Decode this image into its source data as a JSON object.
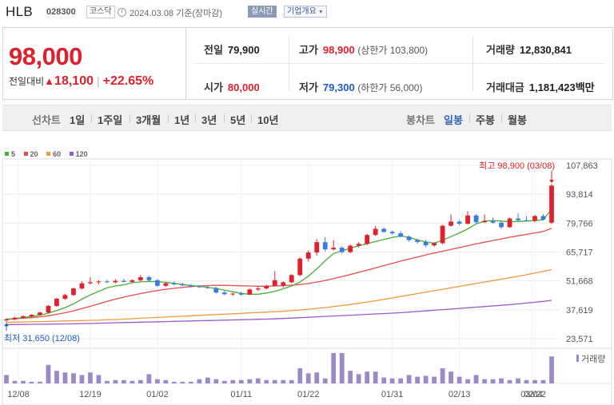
{
  "header": {
    "name": "HLB",
    "code": "028300",
    "market": "코스닥",
    "date": "2024.03.08 기준(장마감)",
    "realtime": "실시간",
    "company_info": "기업개요"
  },
  "quote": {
    "price": "98,000",
    "change_label": "전일대비",
    "change_value": "18,100",
    "change_rate": "+22.65%",
    "prev_close_label": "전일",
    "prev_close": "79,900",
    "high_label": "고가",
    "high": "98,900",
    "upper_limit": "(상한가 103,800)",
    "volume_label": "거래량",
    "volume": "12,830,841",
    "open_label": "시가",
    "open": "80,000",
    "low_label": "저가",
    "low": "79,300",
    "lower_limit": "(하한가 56,000)",
    "amount_label": "거래대금",
    "amount": "1,181,423",
    "amount_unit": "백만"
  },
  "period_tabs": {
    "label": "선차트",
    "items": [
      "1일",
      "1주일",
      "3개월",
      "1년",
      "3년",
      "5년",
      "10년"
    ]
  },
  "candle_tabs": {
    "label": "봉차트",
    "items": [
      "일봉",
      "주봉",
      "월봉"
    ],
    "active": "일봉"
  },
  "colors": {
    "up": "#e0202c",
    "down": "#3a7be0",
    "ma5": "#45b035",
    "ma20": "#e84c4c",
    "ma60": "#f09a3e",
    "ma120": "#9b59c9",
    "volume": "#9b8ac9"
  },
  "chart_data": {
    "type": "candlestick",
    "legend": [
      "5",
      "20",
      "60",
      "120"
    ],
    "y_ticks": [
      "107,863",
      "93,814",
      "79,766",
      "65,717",
      "51,668",
      "37,619",
      "23,571"
    ],
    "y_range": [
      23571,
      107863
    ],
    "x_ticks": [
      "12/08",
      "12/19",
      "01/02",
      "01/11",
      "01/22",
      "01/31",
      "02/13",
      "02/22",
      "03/04"
    ],
    "high_annotation": "최고 98,900 (03/08)",
    "low_annotation": "최저 31,650 (12/08)",
    "volume_label": "거래량",
    "candles": [
      {
        "o": 32500,
        "h": 33500,
        "l": 31650,
        "c": 33000
      },
      {
        "o": 33000,
        "h": 34200,
        "l": 32600,
        "c": 33800
      },
      {
        "o": 33800,
        "h": 35000,
        "l": 33400,
        "c": 34500
      },
      {
        "o": 34500,
        "h": 35500,
        "l": 34000,
        "c": 35200
      },
      {
        "o": 35200,
        "h": 36800,
        "l": 34900,
        "c": 36300
      },
      {
        "o": 36300,
        "h": 40000,
        "l": 36000,
        "c": 39500
      },
      {
        "o": 39500,
        "h": 43500,
        "l": 39000,
        "c": 43000
      },
      {
        "o": 43000,
        "h": 45500,
        "l": 42500,
        "c": 44800
      },
      {
        "o": 44800,
        "h": 48500,
        "l": 44500,
        "c": 48000
      },
      {
        "o": 48000,
        "h": 51500,
        "l": 47500,
        "c": 50500
      },
      {
        "o": 50500,
        "h": 53500,
        "l": 50000,
        "c": 51000
      },
      {
        "o": 51000,
        "h": 52000,
        "l": 50000,
        "c": 51400
      },
      {
        "o": 51400,
        "h": 52200,
        "l": 50600,
        "c": 51000
      },
      {
        "o": 51000,
        "h": 52500,
        "l": 50500,
        "c": 51700
      },
      {
        "o": 51700,
        "h": 52700,
        "l": 50900,
        "c": 51200
      },
      {
        "o": 51200,
        "h": 52500,
        "l": 50800,
        "c": 52000
      },
      {
        "o": 52000,
        "h": 54500,
        "l": 51500,
        "c": 53500
      },
      {
        "o": 53500,
        "h": 54200,
        "l": 51500,
        "c": 52000
      },
      {
        "o": 52000,
        "h": 52600,
        "l": 48800,
        "c": 49300
      },
      {
        "o": 49300,
        "h": 51200,
        "l": 48800,
        "c": 50500
      },
      {
        "o": 50500,
        "h": 51500,
        "l": 49500,
        "c": 50000
      },
      {
        "o": 50000,
        "h": 50800,
        "l": 49200,
        "c": 49500
      },
      {
        "o": 49500,
        "h": 50200,
        "l": 48500,
        "c": 49000
      },
      {
        "o": 49000,
        "h": 49600,
        "l": 48200,
        "c": 48600
      },
      {
        "o": 48600,
        "h": 49200,
        "l": 47800,
        "c": 48200
      },
      {
        "o": 48200,
        "h": 48800,
        "l": 45500,
        "c": 46000
      },
      {
        "o": 46000,
        "h": 46800,
        "l": 44800,
        "c": 45200
      },
      {
        "o": 45200,
        "h": 46000,
        "l": 44500,
        "c": 45500
      },
      {
        "o": 45500,
        "h": 46500,
        "l": 44500,
        "c": 45000
      },
      {
        "o": 45000,
        "h": 48000,
        "l": 44800,
        "c": 47500
      },
      {
        "o": 47500,
        "h": 49000,
        "l": 46800,
        "c": 48000
      },
      {
        "o": 48000,
        "h": 49800,
        "l": 47500,
        "c": 49200
      },
      {
        "o": 49200,
        "h": 56500,
        "l": 49000,
        "c": 52000
      },
      {
        "o": 49500,
        "h": 51500,
        "l": 48500,
        "c": 51000
      },
      {
        "o": 51000,
        "h": 55000,
        "l": 50500,
        "c": 54500
      },
      {
        "o": 54500,
        "h": 63000,
        "l": 54000,
        "c": 62500
      },
      {
        "o": 62500,
        "h": 66500,
        "l": 61000,
        "c": 65500
      },
      {
        "o": 65500,
        "h": 72000,
        "l": 64000,
        "c": 70500
      },
      {
        "o": 70500,
        "h": 73000,
        "l": 66000,
        "c": 67000
      },
      {
        "o": 67000,
        "h": 71500,
        "l": 66500,
        "c": 67800
      },
      {
        "o": 67800,
        "h": 68500,
        "l": 65000,
        "c": 65700
      },
      {
        "o": 65700,
        "h": 69500,
        "l": 65200,
        "c": 68800
      },
      {
        "o": 68800,
        "h": 70500,
        "l": 68000,
        "c": 69700
      },
      {
        "o": 69700,
        "h": 74500,
        "l": 69000,
        "c": 74000
      },
      {
        "o": 74000,
        "h": 78500,
        "l": 73500,
        "c": 77000
      },
      {
        "o": 77000,
        "h": 77800,
        "l": 75000,
        "c": 75500
      },
      {
        "o": 75500,
        "h": 76200,
        "l": 74200,
        "c": 74800
      },
      {
        "o": 74800,
        "h": 75800,
        "l": 72800,
        "c": 73200
      },
      {
        "o": 73200,
        "h": 73800,
        "l": 70800,
        "c": 71500
      },
      {
        "o": 71500,
        "h": 72200,
        "l": 69800,
        "c": 70600
      },
      {
        "o": 70600,
        "h": 71600,
        "l": 68000,
        "c": 69000
      },
      {
        "o": 69000,
        "h": 70500,
        "l": 68300,
        "c": 70000
      },
      {
        "o": 70000,
        "h": 79000,
        "l": 69500,
        "c": 78500
      },
      {
        "o": 78500,
        "h": 84000,
        "l": 78000,
        "c": 80500
      },
      {
        "o": 80500,
        "h": 81200,
        "l": 78800,
        "c": 79500
      },
      {
        "o": 79500,
        "h": 85500,
        "l": 79000,
        "c": 83500
      },
      {
        "o": 83500,
        "h": 84200,
        "l": 79500,
        "c": 80200
      },
      {
        "o": 80200,
        "h": 84000,
        "l": 79800,
        "c": 80800
      },
      {
        "o": 80800,
        "h": 82500,
        "l": 79500,
        "c": 80000
      },
      {
        "o": 80000,
        "h": 80800,
        "l": 77000,
        "c": 77800
      },
      {
        "o": 77800,
        "h": 82500,
        "l": 77500,
        "c": 82000
      },
      {
        "o": 82000,
        "h": 84500,
        "l": 80800,
        "c": 81200
      },
      {
        "o": 81200,
        "h": 83200,
        "l": 80500,
        "c": 81000
      },
      {
        "o": 81000,
        "h": 83800,
        "l": 80200,
        "c": 83200
      },
      {
        "o": 83200,
        "h": 84200,
        "l": 81000,
        "c": 81500
      },
      {
        "o": 80000,
        "h": 98900,
        "l": 79300,
        "c": 98000
      }
    ],
    "volumes": [
      10,
      3,
      3,
      2,
      2,
      22,
      15,
      13,
      12,
      10,
      13,
      10,
      3,
      4,
      4,
      3,
      4,
      11,
      5,
      4,
      2,
      2,
      2,
      5,
      7,
      5,
      3,
      4,
      4,
      5,
      6,
      4,
      4,
      4,
      4,
      18,
      12,
      13,
      6,
      36,
      36,
      15,
      11,
      14,
      14,
      7,
      6,
      6,
      10,
      8,
      9,
      8,
      18,
      14,
      8,
      5,
      10,
      5,
      5,
      6,
      4,
      6,
      4,
      4,
      4,
      32
    ],
    "ma5": [
      33000,
      33400,
      33800,
      34400,
      35000,
      36000,
      37300,
      38700,
      40500,
      42800,
      44800,
      46600,
      48300,
      49200,
      49800,
      50800,
      51200,
      51400,
      51300,
      51000,
      50500,
      49900,
      49400,
      49000,
      48600,
      48000,
      47200,
      46400,
      45600,
      45200,
      45200,
      45800,
      46600,
      47800,
      49200,
      51100,
      54000,
      57500,
      61500,
      65000,
      66300,
      67600,
      68800,
      69800,
      70800,
      71800,
      72800,
      73500,
      72900,
      71600,
      70600,
      70000,
      71500,
      73200,
      75000,
      77000,
      79400,
      80800,
      81000,
      80800,
      80400,
      80600,
      80800,
      81000,
      81400,
      86500
    ],
    "ma20": [
      33000,
      33200,
      33500,
      33800,
      34200,
      34700,
      35400,
      36200,
      37100,
      38200,
      39300,
      40500,
      41700,
      42800,
      43800,
      44700,
      45500,
      46300,
      47000,
      47600,
      48100,
      48500,
      48900,
      49200,
      49400,
      49500,
      49500,
      49400,
      49300,
      49200,
      49100,
      49100,
      49200,
      49400,
      49600,
      49900,
      50400,
      51100,
      51900,
      52800,
      53800,
      54800,
      55800,
      56900,
      58000,
      59100,
      60200,
      61300,
      62300,
      63300,
      64300,
      65200,
      66100,
      67000,
      67900,
      68800,
      69700,
      70500,
      71300,
      72100,
      72900,
      73600,
      74300,
      75000,
      75700,
      77200
    ],
    "ma60": [
      31500,
      31600,
      31700,
      31800,
      31900,
      32000,
      32100,
      32200,
      32300,
      32400,
      32500,
      32600,
      32800,
      32900,
      33100,
      33300,
      33500,
      33700,
      33900,
      34100,
      34300,
      34500,
      34700,
      34900,
      35100,
      35300,
      35500,
      35700,
      35900,
      36100,
      36300,
      36500,
      36700,
      36900,
      37200,
      37500,
      37900,
      38300,
      38700,
      39200,
      39700,
      40200,
      40800,
      41400,
      42000,
      42700,
      43400,
      44100,
      44800,
      45500,
      46200,
      46900,
      47600,
      48300,
      49000,
      49700,
      50400,
      51100,
      51800,
      52500,
      53200,
      53900,
      54700,
      55500,
      56300,
      57200
    ],
    "ma120": [
      30400,
      30450,
      30500,
      30550,
      30600,
      30650,
      30700,
      30750,
      30800,
      30900,
      31000,
      31100,
      31200,
      31300,
      31400,
      31500,
      31600,
      31700,
      31800,
      31900,
      32000,
      32100,
      32200,
      32300,
      32400,
      32500,
      32600,
      32700,
      32800,
      32900,
      33000,
      33100,
      33200,
      33400,
      33600,
      33800,
      34000,
      34200,
      34400,
      34600,
      34800,
      35000,
      35200,
      35400,
      35600,
      35800,
      36000,
      36200,
      36500,
      36800,
      37100,
      37400,
      37700,
      38000,
      38300,
      38600,
      38900,
      39200,
      39500,
      39800,
      40100,
      40500,
      40900,
      41300,
      41700,
      42200
    ]
  }
}
